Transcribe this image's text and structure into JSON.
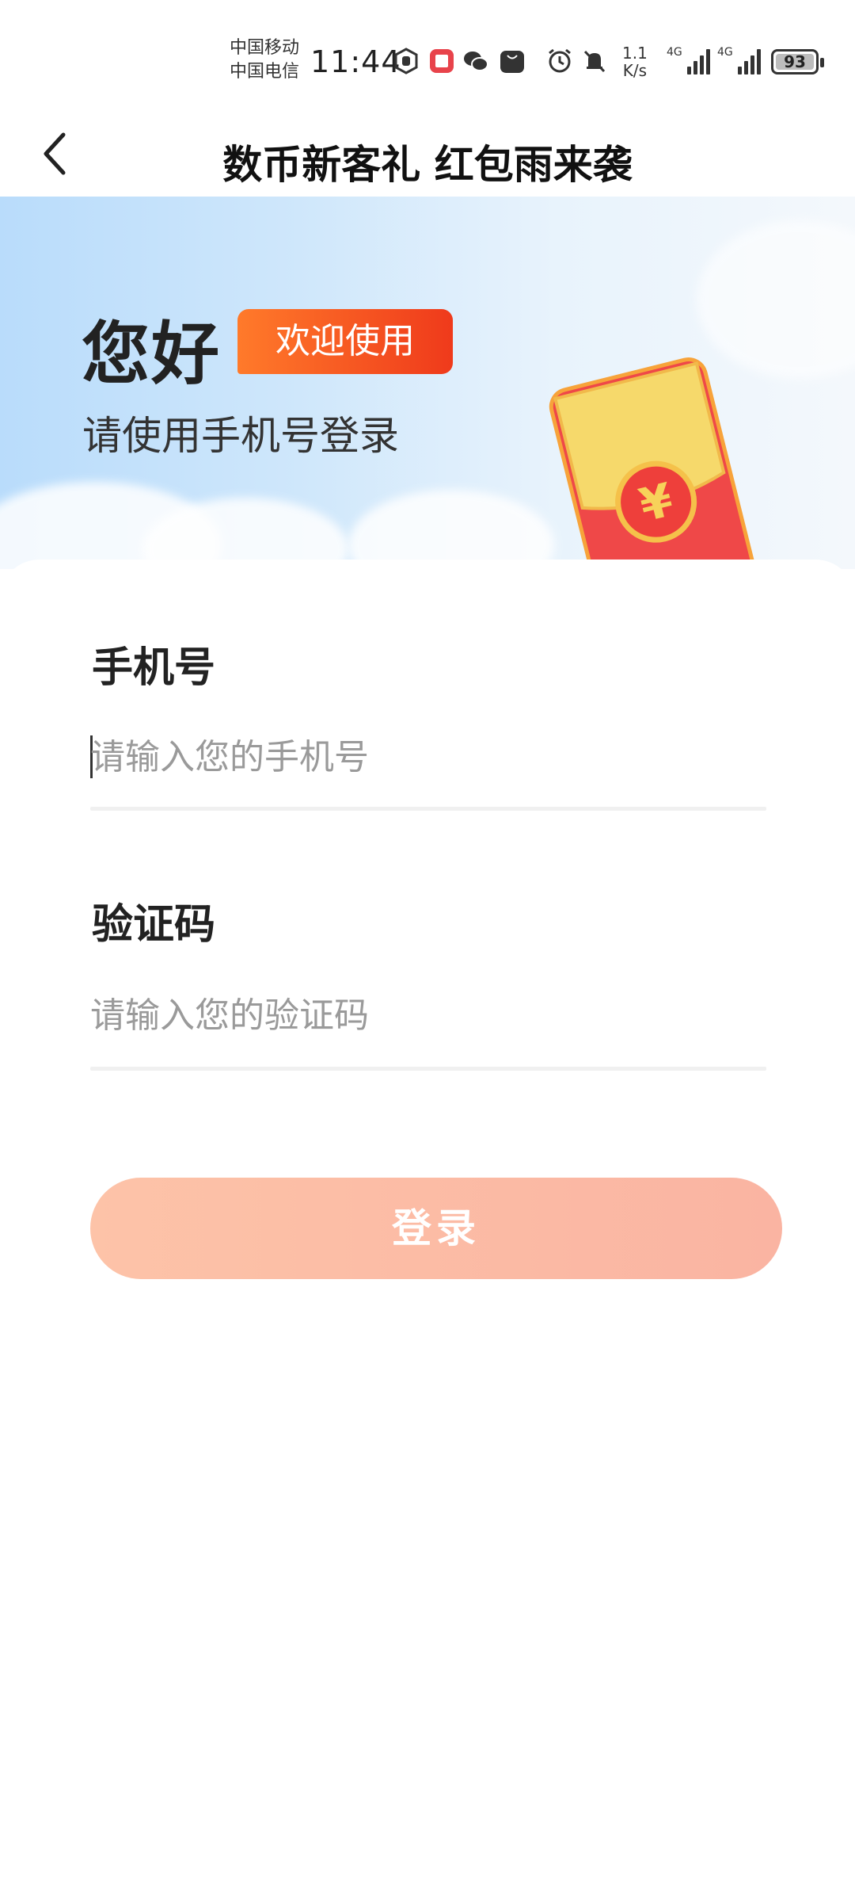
{
  "status_bar": {
    "carrier_1": "中国移动",
    "carrier_2": "中国电信",
    "time": "11:44",
    "net_speed_value": "1.1",
    "net_speed_unit": "K/s",
    "network_1": "4G",
    "network_2": "4G",
    "battery": "93",
    "icons": [
      "hand-icon",
      "book-app-icon",
      "wechat-icon",
      "huawei-appgallery-icon",
      "alarm-icon",
      "mute-icon"
    ]
  },
  "header": {
    "title": "数币新客礼 红包雨来袭"
  },
  "banner": {
    "greeting": "您好",
    "welcome_badge": "欢迎使用",
    "subtitle": "请使用手机号登录"
  },
  "form": {
    "phone_label": "手机号",
    "phone_placeholder": "请输入您的手机号",
    "phone_value": "",
    "code_label": "验证码",
    "code_placeholder": "请输入您的验证码",
    "code_value": "",
    "login_button": "登录"
  },
  "colors": {
    "accent": "#ef3a1b",
    "login_button_start": "#fdc3a8",
    "login_button_end": "#fab4a2",
    "banner_blue": "#b9dcfb"
  }
}
